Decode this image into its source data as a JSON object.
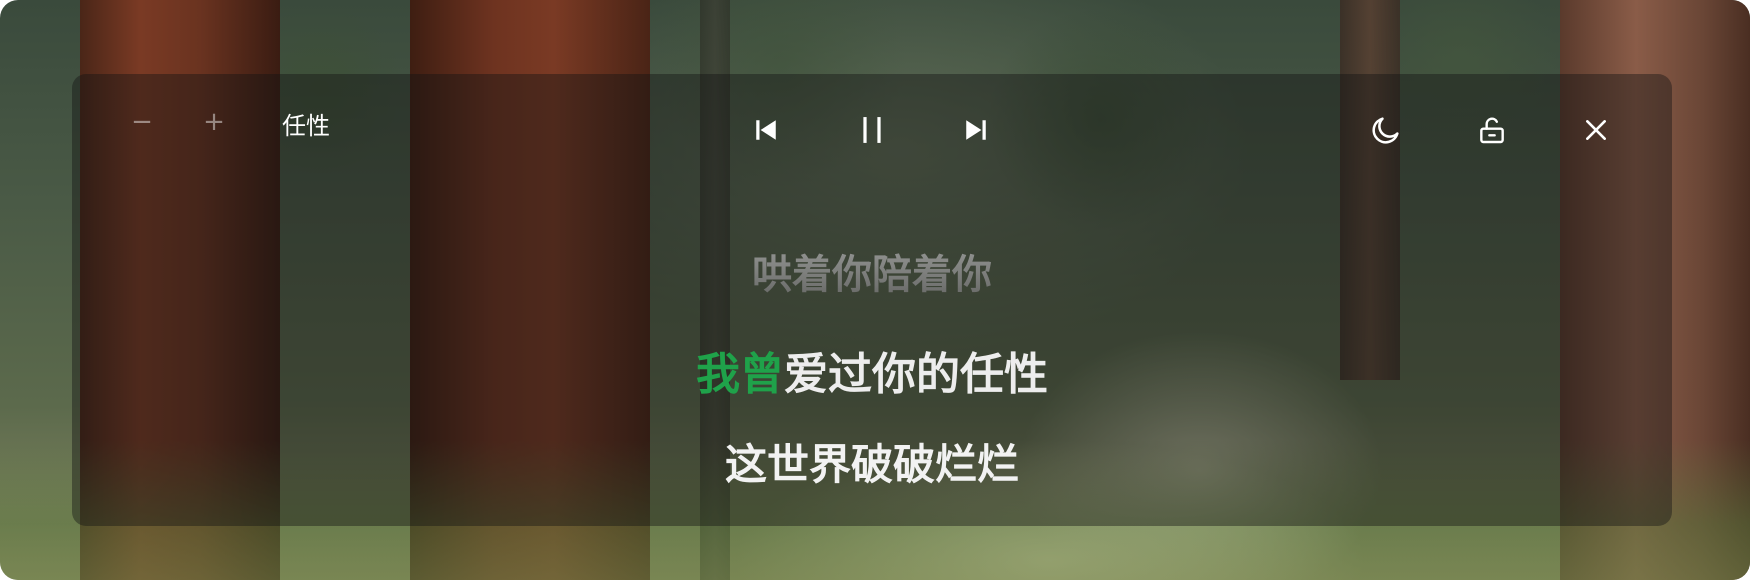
{
  "song": {
    "title": "任性"
  },
  "controls": {
    "font_decrease": "−",
    "font_increase": "+"
  },
  "icons": {
    "prev": "skip-previous-icon",
    "pause": "pause-icon",
    "next": "skip-next-icon",
    "theme": "moon-icon",
    "lock": "unlock-icon",
    "close": "close-icon"
  },
  "lyrics": {
    "previous": "哄着你陪着你",
    "current_sung": "我曾",
    "current_unsung": "爱过你的任性",
    "next": "这世界破破烂烂"
  },
  "colors": {
    "highlight": "#1fa24a",
    "lyric_text": "#ededed",
    "panel_bg": "rgba(20,20,18,0.42)"
  }
}
